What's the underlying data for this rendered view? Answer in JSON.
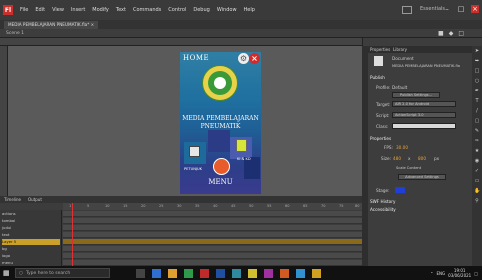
{
  "app": {
    "logo": "Fl",
    "menu": [
      "File",
      "Edit",
      "View",
      "Insert",
      "Modify",
      "Text",
      "Commands",
      "Control",
      "Debug",
      "Window",
      "Help"
    ],
    "workspace": "Essentials"
  },
  "document": {
    "tab_title": "MEDIA PEMBELAJARAN PNEUMATIK.fla* ×",
    "scene": "Scene 1"
  },
  "stage": {
    "home_label": "HOME",
    "settings_icon": "gear-icon",
    "close_icon": "close-icon",
    "title_line1": "MEDIA PEMBELAJARAN",
    "title_line2": "PNEUMATIK",
    "petunjuk_label": "PETUNJUK",
    "kd_label": "KI & KD",
    "menu_label": "MENU",
    "colors": {
      "bg_top": "#2f7fa5",
      "bg_bottom": "#3a3b8c",
      "menu_button": "#e85b2a",
      "close": "#d42a2a"
    }
  },
  "properties": {
    "tabs": [
      "Properties",
      "Library"
    ],
    "doc_type": "Document",
    "doc_name": "MEDIA PEMBELAJARAN PNEUMATIK.fla",
    "publish_section": "Publish",
    "profile_label": "Profile:",
    "profile_value": "Default",
    "publish_settings": "Publish Settings...",
    "target_label": "Target:",
    "target_value": "AIR 2.0 for Android",
    "script_label": "Script:",
    "script_value": "ActionScript 3.0",
    "class_label": "Class:",
    "class_value": "",
    "props_section": "Properties",
    "fps_label": "FPS:",
    "fps_value": "30.00",
    "size_label": "Size:",
    "size_w": "480",
    "size_x": "x",
    "size_h": "800",
    "size_unit": "px",
    "scale_content": "Scale Content",
    "advanced_settings": "Advanced Settings",
    "stage_label": "Stage:",
    "stage_color": "#1f3fd8",
    "swf_history": "SWF History",
    "accessibility": "Accessibility"
  },
  "timeline": {
    "tabs": [
      "Timeline",
      "Output"
    ],
    "frame_numbers": [
      "1",
      "5",
      "10",
      "15",
      "20",
      "25",
      "30",
      "35",
      "40",
      "45",
      "50",
      "55",
      "60",
      "65",
      "70",
      "75",
      "80"
    ],
    "layers": [
      "actions",
      "tombol",
      "judul",
      "text",
      "Layer 5",
      "bg",
      "logo",
      "menu"
    ],
    "selected_layer_index": 4
  },
  "taskbar": {
    "search_placeholder": "Type here to search",
    "time": "19:01",
    "date": "03/06/2021",
    "language": "ENG"
  }
}
